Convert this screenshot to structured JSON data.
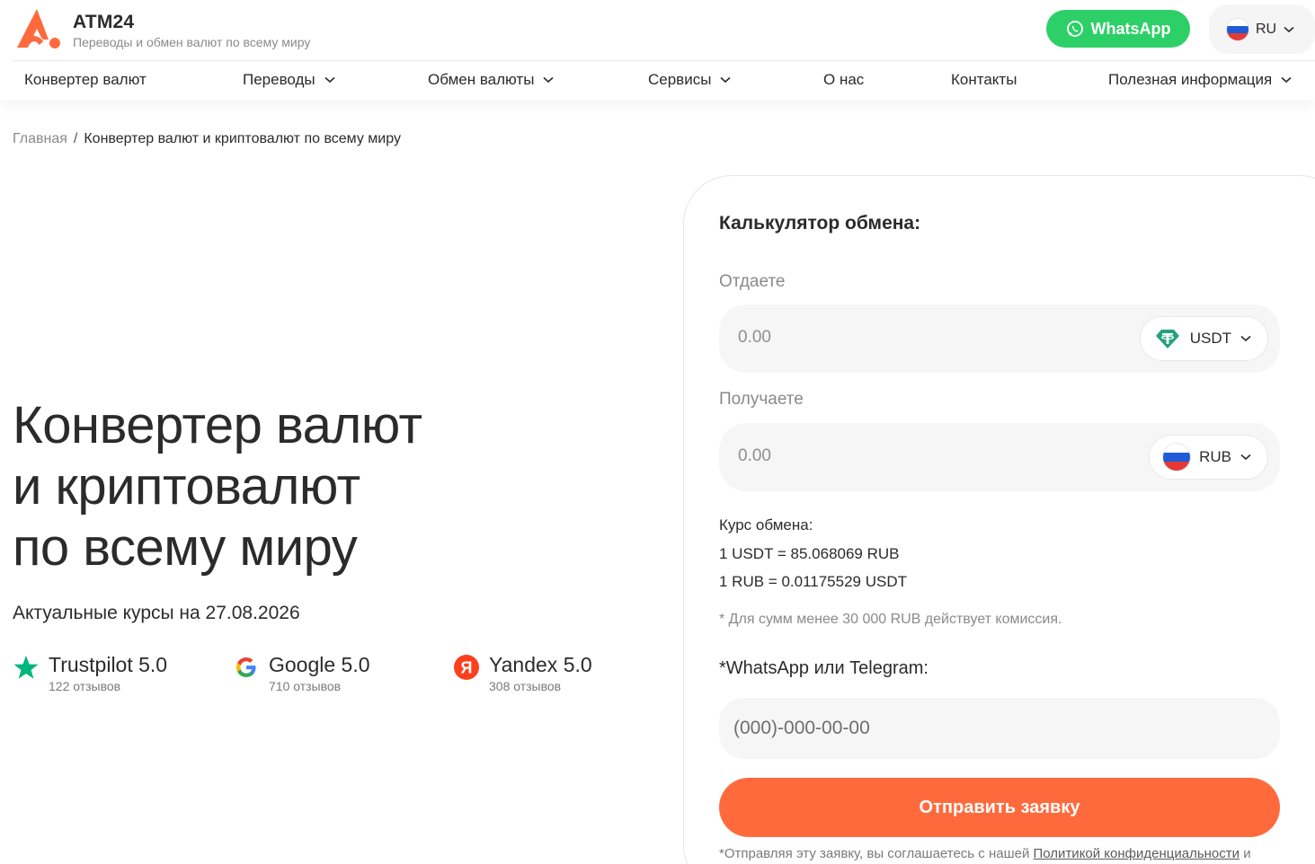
{
  "brand": {
    "name": "ATM24",
    "tagline": "Переводы и обмен валют по всему миру"
  },
  "header": {
    "whatsapp_label": "WhatsApp",
    "language": "RU"
  },
  "nav": {
    "items": [
      {
        "label": "Конвертер валют",
        "dropdown": false
      },
      {
        "label": "Переводы",
        "dropdown": true
      },
      {
        "label": "Обмен валюты",
        "dropdown": true
      },
      {
        "label": "Сервисы",
        "dropdown": true
      },
      {
        "label": "О нас",
        "dropdown": false
      },
      {
        "label": "Контакты",
        "dropdown": false
      },
      {
        "label": "Полезная информация",
        "dropdown": true
      }
    ]
  },
  "breadcrumb": {
    "home": "Главная",
    "separator": "/",
    "current": "Конвертер валют и криптовалют по всему миру"
  },
  "hero": {
    "title_lines": [
      "Конвертер валют",
      "и криптовалют",
      "по всему миру"
    ],
    "rates_date": "Актуальные курсы на 27.08.2026"
  },
  "ratings": [
    {
      "title": "Trustpilot 5.0",
      "reviews": "122 отзывов",
      "icon": "trustpilot-star-icon"
    },
    {
      "title": "Google 5.0",
      "reviews": "710 отзывов",
      "icon": "google-icon"
    },
    {
      "title": "Yandex 5.0",
      "reviews": "308 отзывов",
      "icon": "yandex-icon"
    }
  ],
  "calculator": {
    "title": "Калькулятор обмена:",
    "give_label": "Отдаете",
    "give_value": "0.00",
    "give_currency": "USDT",
    "receive_label": "Получаете",
    "receive_value": "0.00",
    "receive_currency": "RUB",
    "rate_label": "Курс обмена:",
    "rate_line_1": "1 USDT = 85.068069 RUB",
    "rate_line_2": "1 RUB = 0.01175529 USDT",
    "commission_note": "* Для сумм менее 30 000 RUB действует комиссия.",
    "contact_label": "*WhatsApp или Telegram:",
    "phone_placeholder": "(000)-000-00-00",
    "submit_label": "Отправить заявку",
    "agree_prefix": "*Отправляя эту заявку, вы соглашаетесь с нашей",
    "agree_link": "Политикой конфиденциальности",
    "agree_suffix": "и"
  },
  "colors": {
    "accent": "#ff6a3d",
    "whatsapp": "#2dd067",
    "text": "#2b2b2b",
    "muted": "#8a8a8a",
    "field_bg": "#f6f6f6"
  }
}
